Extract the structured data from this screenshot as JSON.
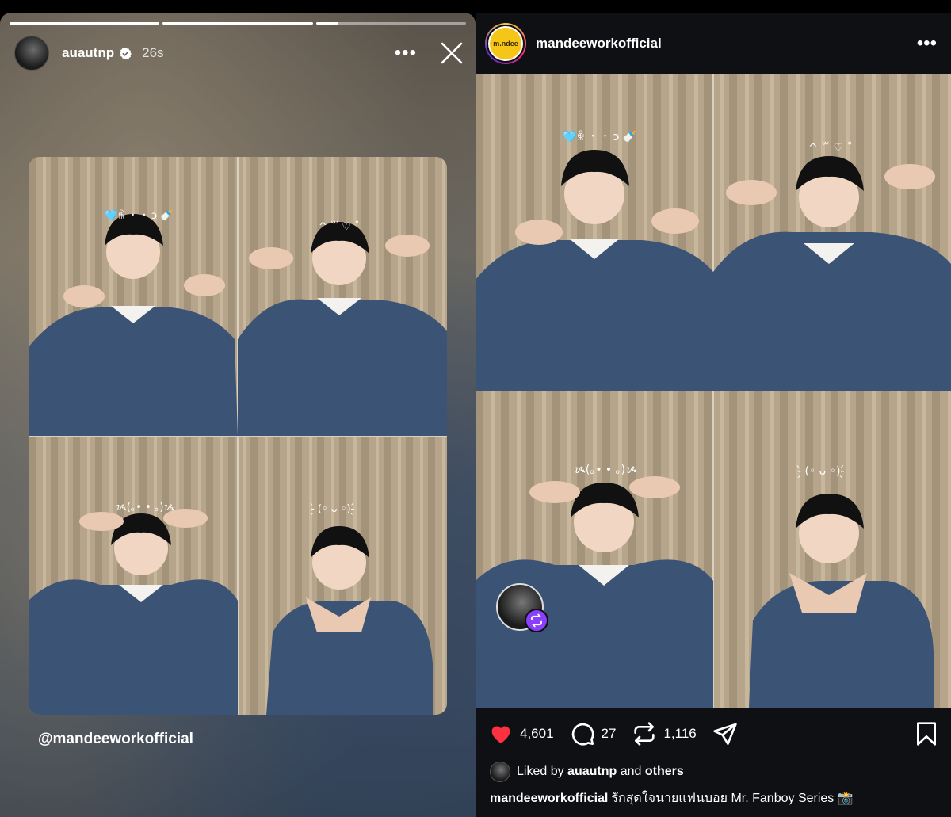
{
  "story": {
    "progress": [
      1,
      1,
      0.15
    ],
    "username": "auautnp",
    "time": "26s",
    "verified_icon": "verified-badge-icon",
    "more_icon": "more-horizontal-icon",
    "close_icon": "close-icon",
    "mention": "@mandeeworkofficial"
  },
  "post": {
    "username": "mandeeworkofficial",
    "avatar_text": "m.ndee",
    "more_icon": "more-horizontal-icon",
    "actions": {
      "likes": "4,601",
      "comments": "27",
      "reposts": "1,116"
    },
    "liked_by_prefix": "Liked by",
    "liked_by_user": "auautnp",
    "liked_by_and": "and",
    "liked_by_others": "others",
    "caption_user": "mandeeworkofficial",
    "caption_text": "รักสุดใจนายแฟนบอย Mr. Fanboy Series 📸"
  },
  "photos": {
    "kaomoji": [
      "🩵ꆜ ・ ・ ɔ 🍼",
      "^ ꒳ ♡ ˚",
      "ᝰ(｡• • ｡)ᝰ",
      "-̗̀ (◦ ᴗ ◦)-̖́"
    ]
  },
  "colors": {
    "background": "#000000",
    "post_bg": "#0e1013",
    "like_red": "#ff3040",
    "repost_purple": "#8a3ffc",
    "robe_blue": "#3d5576",
    "curtain": "#b7a78c"
  }
}
